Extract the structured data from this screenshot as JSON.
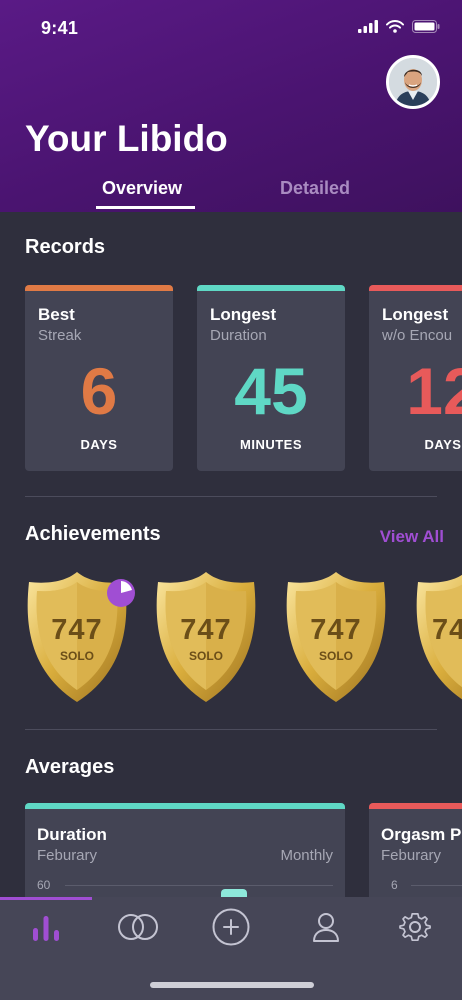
{
  "status_bar": {
    "time": "9:41"
  },
  "header": {
    "title": "Your Libido",
    "avatar_icon": "user-avatar"
  },
  "tabs": [
    {
      "label": "Overview",
      "active": true
    },
    {
      "label": "Detailed",
      "active": false
    }
  ],
  "records": {
    "title": "Records",
    "cards": [
      {
        "title": "Best",
        "subtitle": "Streak",
        "value": "6",
        "unit": "DAYS",
        "color": "#e07a45"
      },
      {
        "title": "Longest",
        "subtitle": "Duration",
        "value": "45",
        "unit": "MINUTES",
        "color": "#5fd8c5"
      },
      {
        "title": "Longest",
        "subtitle": "w/o Encou",
        "value": "12",
        "unit": "DAYS",
        "color": "#e85a5a"
      }
    ]
  },
  "achievements": {
    "title": "Achievements",
    "view_all": "View All",
    "badges": [
      {
        "number": "747",
        "label": "SOLO"
      },
      {
        "number": "747",
        "label": "SOLO"
      },
      {
        "number": "747",
        "label": "SOLO"
      },
      {
        "number": "74",
        "label": ""
      }
    ],
    "progress_color": "#a04ed3"
  },
  "averages": {
    "title": "Averages",
    "cards": [
      {
        "title": "Duration",
        "subtitle": "Feburary",
        "period": "Monthly",
        "tick": "60",
        "color": "#5fd8c5"
      },
      {
        "title": "Orgasm P",
        "subtitle": "Feburary",
        "period": "",
        "tick": "6",
        "color": "#e85a5a"
      }
    ]
  },
  "nav": {
    "items": [
      {
        "icon": "stats-icon",
        "active": true
      },
      {
        "icon": "rings-icon",
        "active": false
      },
      {
        "icon": "add-icon",
        "active": false
      },
      {
        "icon": "profile-icon",
        "active": false
      },
      {
        "icon": "settings-icon",
        "active": false
      }
    ],
    "active_color": "#a04ed3"
  }
}
